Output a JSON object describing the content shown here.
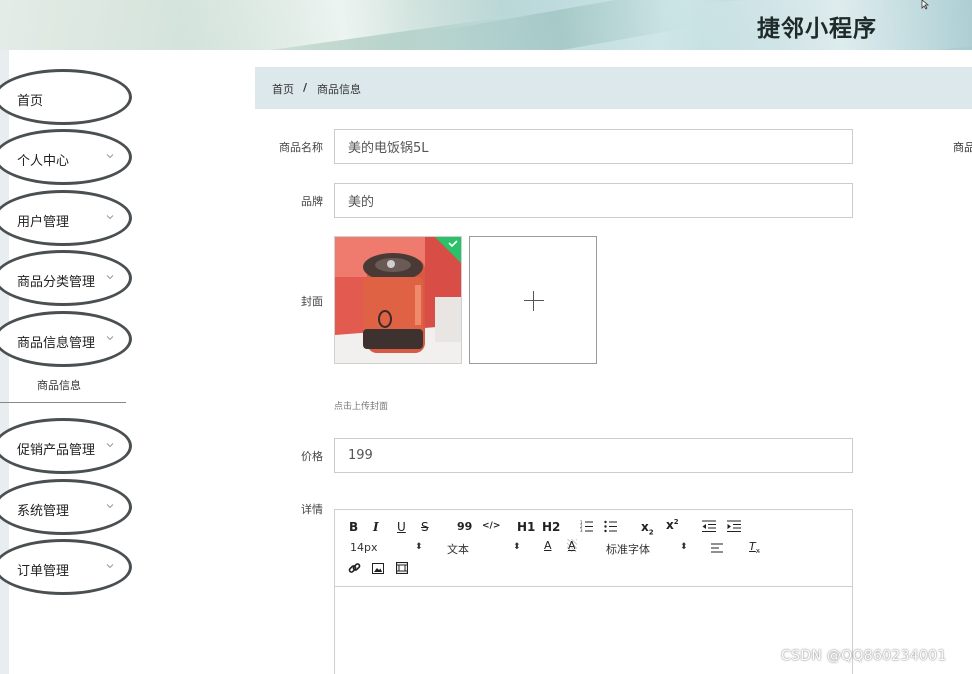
{
  "header": {
    "app_title": "捷邻小程序"
  },
  "sidebar": {
    "items": [
      {
        "label": "首页",
        "has_chevron": false
      },
      {
        "label": "个人中心",
        "has_chevron": true
      },
      {
        "label": "用户管理",
        "has_chevron": true
      },
      {
        "label": "商品分类管理",
        "has_chevron": true
      },
      {
        "label": "商品信息管理",
        "has_chevron": true
      },
      {
        "label": "促销产品管理",
        "has_chevron": true
      },
      {
        "label": "系统管理",
        "has_chevron": true
      },
      {
        "label": "订单管理",
        "has_chevron": true
      }
    ],
    "submenu": {
      "label": "商品信息"
    }
  },
  "breadcrumb": {
    "home": "首页",
    "separator": "/",
    "current": "商品信息"
  },
  "form": {
    "name": {
      "label": "商品名称",
      "value": "美的电饭锅5L"
    },
    "brand": {
      "label": "品牌",
      "value": "美的"
    },
    "cover": {
      "label": "封面",
      "hint": "点击上传封面"
    },
    "price": {
      "label": "价格",
      "value": "199"
    },
    "detail": {
      "label": "详情"
    }
  },
  "editor_toolbar": {
    "bold": "B",
    "italic": "I",
    "underline": "U",
    "strike": "S",
    "quote": "99",
    "code": "</>",
    "h1": "H1",
    "h2": "H2",
    "font_size": "14px",
    "paragraph": "文本",
    "font_family": "标准字体"
  },
  "right_edge_label": "商品",
  "watermark": "CSDN @QQ860234001",
  "colors": {
    "breadcrumb_bg": "#dde8ec",
    "upload_check": "#2bc06a",
    "menu_border": "#4a4f52"
  }
}
